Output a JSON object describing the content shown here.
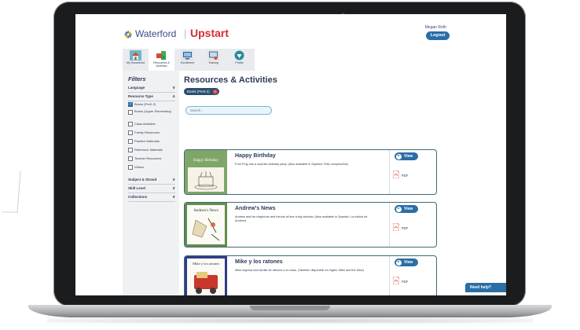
{
  "header": {
    "brand": "Waterford",
    "product": "Upstart",
    "user_name": "Megan Roth",
    "logout_label": "Logout"
  },
  "nav": {
    "tabs": [
      {
        "label": "My Household",
        "icon": "house-icon"
      },
      {
        "label": "Resources & Activities",
        "icon": "puzzle-icon"
      },
      {
        "label": "Enrollment",
        "icon": "enrollment-icon"
      },
      {
        "label": "Training",
        "icon": "training-icon"
      },
      {
        "label": "Profile",
        "icon": "profile-icon"
      }
    ]
  },
  "filters": {
    "title": "Filters",
    "language": "Language",
    "resource_type": "Resource Type",
    "options": [
      {
        "label": "Books (PreK-2)",
        "checked": true
      },
      {
        "label": "Books (Upper Elementary)",
        "checked": false
      },
      {
        "label": "Class Activities",
        "checked": false
      },
      {
        "label": "Family Resources",
        "checked": false
      },
      {
        "label": "Practice Materials",
        "checked": false
      },
      {
        "label": "Reference Materials",
        "checked": false
      },
      {
        "label": "Teacher Resources",
        "checked": false
      },
      {
        "label": "Videos",
        "checked": false
      }
    ],
    "subject_strand": "Subject & Strand",
    "skill_level": "Skill Level",
    "collections": "Collections"
  },
  "main": {
    "title": "Resources & Activities",
    "chip_label": "Books (PreK-2)",
    "search_placeholder": "Search...",
    "cards": [
      {
        "title": "Happy Birthday",
        "description": "Fran Frog has a surprise birthday party. (Also available in Spanish: Feliz cumpleaños)",
        "thumb_title": "Happy Birthday",
        "view_label": "View",
        "pdf_label": "PDF"
      },
      {
        "title": "Andrew's News",
        "description": "Andrew and his neighbors and friends all see a big rainbow. (Also available in Spanish: La noticia de Andrew)",
        "thumb_title": "Andrew's News",
        "view_label": "View",
        "pdf_label": "PDF"
      },
      {
        "title": "Mike y los ratones",
        "description": "Mike regresa una familia de ratones a su casa. (También disponible en inglés: Mike and the Mice)",
        "thumb_title": "Mike y los ratones",
        "view_label": "View",
        "pdf_label": "PDF"
      }
    ]
  },
  "help_label": "Need help?",
  "colors": {
    "brand_blue": "#2a6ea6",
    "upstart_red": "#d52b31",
    "card_border": "#3f6a78",
    "thumb_green": "#5f8f4a",
    "thumb_navy": "#2f3c8a"
  }
}
